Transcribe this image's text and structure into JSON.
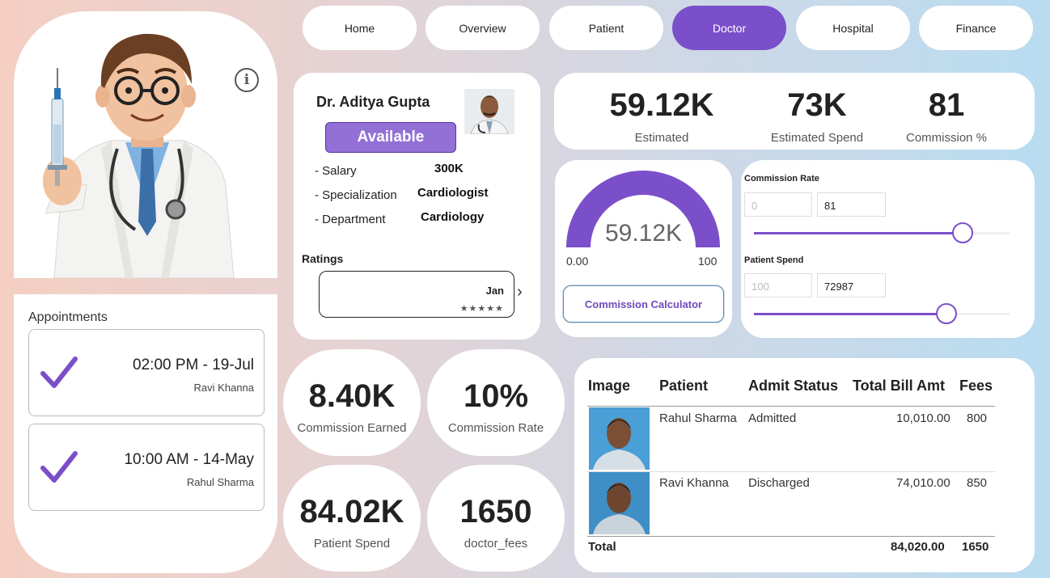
{
  "nav": {
    "items": [
      "Home",
      "Overview",
      "Patient",
      "Doctor",
      "Hospital",
      "Finance"
    ],
    "active": "Doctor"
  },
  "appointments": {
    "title": "Appointments",
    "items": [
      {
        "time": "02:00 PM - 19-Jul",
        "name": "Ravi Khanna"
      },
      {
        "time": "10:00 AM - 14-May",
        "name": "Rahul Sharma"
      }
    ]
  },
  "doctor": {
    "name": "Dr. Aditya Gupta",
    "status": "Available",
    "salary_label": "- Salary",
    "salary": "300K",
    "specialization_label": "- Specialization",
    "specialization": "Cardiologist",
    "department_label": "- Department",
    "department": "Cardiology",
    "ratings_label": "Ratings",
    "ratings_month": "Jan",
    "ratings_stars": "★★★★★"
  },
  "kpi_top": [
    {
      "value": "59.12K",
      "label": "Estimated"
    },
    {
      "value": "73K",
      "label": "Estimated Spend"
    },
    {
      "value": "81",
      "label": "Commission %"
    }
  ],
  "gauge": {
    "value": "59.12K",
    "min": "0.00",
    "max": "100",
    "fraction": 1.0,
    "button_label": "Commission Calculator"
  },
  "sliders": {
    "commission_rate": {
      "title": "Commission Rate",
      "min": "0",
      "value": "81",
      "fraction": 0.81
    },
    "patient_spend": {
      "title": "Patient Spend",
      "min": "100",
      "value": "72987",
      "fraction": 0.75
    }
  },
  "circle_kpis": [
    {
      "value": "8.40K",
      "label": "Commission Earned"
    },
    {
      "value": "10%",
      "label": "Commission Rate"
    },
    {
      "value": "84.02K",
      "label": "Patient Spend"
    },
    {
      "value": "1650",
      "label": "doctor_fees"
    }
  ],
  "table": {
    "headers": [
      "Image",
      "Patient",
      "Admit Status",
      "Total Bill Amt",
      "Fees"
    ],
    "rows": [
      {
        "patient": "Rahul Sharma",
        "status": "Admitted",
        "bill": "10,010.00",
        "fees": "800"
      },
      {
        "patient": "Ravi Khanna",
        "status": "Discharged",
        "bill": "74,010.00",
        "fees": "850"
      }
    ],
    "total_label": "Total",
    "total_bill": "84,020.00",
    "total_fees": "1650"
  },
  "colors": {
    "accent": "#7b4fc9",
    "available": "#9270d6"
  }
}
